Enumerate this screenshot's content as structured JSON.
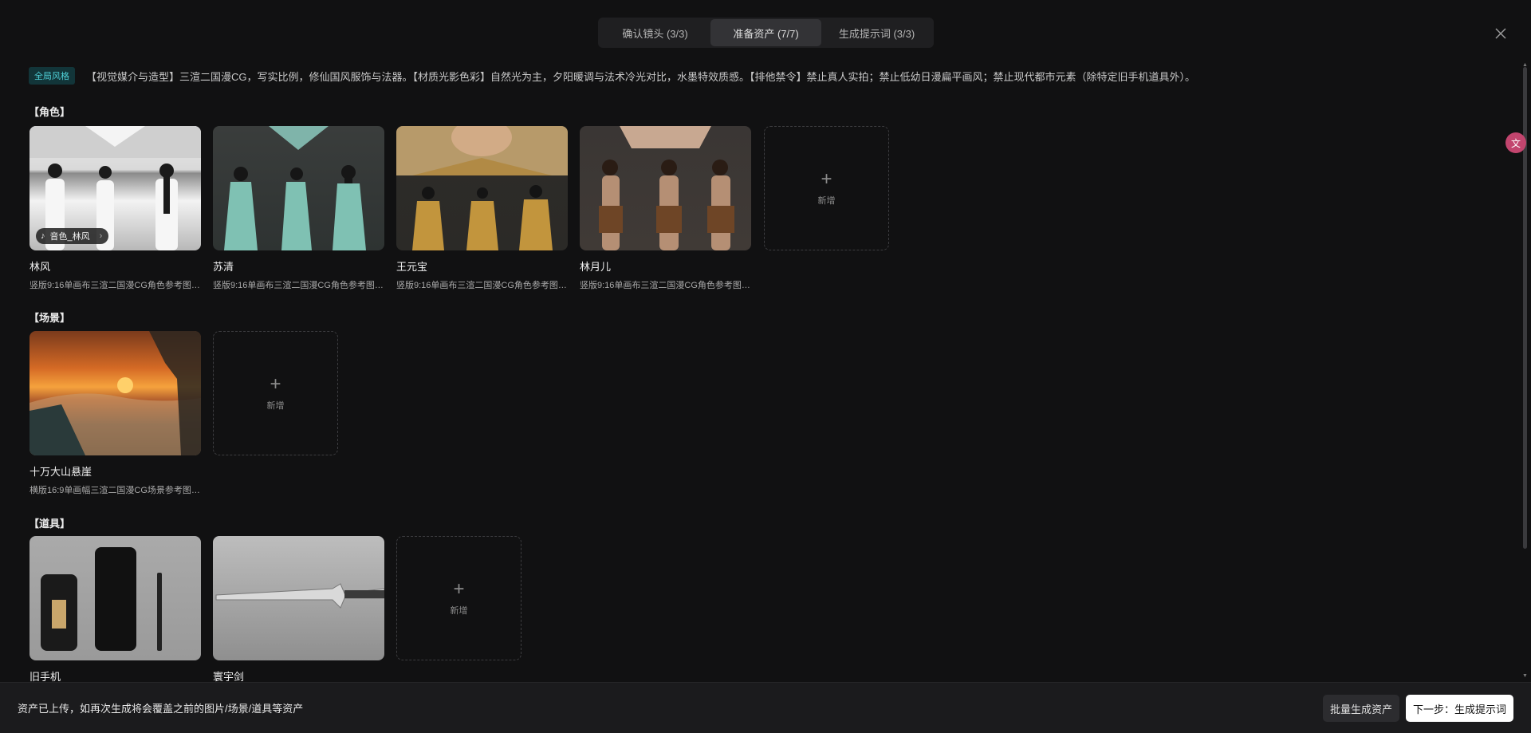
{
  "tabs": [
    {
      "label": "确认镜头 (3/3)"
    },
    {
      "label": "准备资产 (7/7)"
    },
    {
      "label": "生成提示词 (3/3)"
    }
  ],
  "global_style": {
    "badge": "全局风格",
    "text": "【视觉媒介与造型】三渲二国漫CG，写实比例，修仙国风服饰与法器。【材质光影色彩】自然光为主，夕阳暖调与法术冷光对比，水墨特效质感。【排他禁令】禁止真人实拍；禁止低幼日漫扁平画风；禁止现代都市元素（除特定旧手机道具外）。"
  },
  "sections": {
    "characters": {
      "title": "【角色】",
      "items": [
        {
          "name": "林风",
          "desc": "竖版9:16单画布三渲二国漫CG角色参考图，...",
          "voice": "音色_林风"
        },
        {
          "name": "苏清",
          "desc": "竖版9:16单画布三渲二国漫CG角色参考图，..."
        },
        {
          "name": "王元宝",
          "desc": "竖版9:16单画布三渲二国漫CG角色参考图，..."
        },
        {
          "name": "林月儿",
          "desc": "竖版9:16单画布三渲二国漫CG角色参考图，..."
        }
      ]
    },
    "scenes": {
      "title": "【场景】",
      "items": [
        {
          "name": "十万大山悬崖",
          "desc": "横版16:9单画幅三渲二国漫CG场景参考图，..."
        }
      ]
    },
    "props": {
      "title": "【道具】",
      "items": [
        {
          "name": "旧手机",
          "desc": ""
        },
        {
          "name": "寰宇剑",
          "desc": ""
        }
      ]
    }
  },
  "add_label": "新增",
  "bottom": {
    "message": "资产已上传，如再次生成将会覆盖之前的图片/场景/道具等资产",
    "batch_button": "批量生成资产",
    "next_button": "下一步：生成提示词"
  },
  "colors": {
    "background": "#111112",
    "tab_active": "#333336",
    "badge_text": "#4fd1d8",
    "primary_button": "#ffffff"
  },
  "icons": [
    "close-icon",
    "plus-icon",
    "voice-icon",
    "chevron-right-icon",
    "translate-icon"
  ]
}
